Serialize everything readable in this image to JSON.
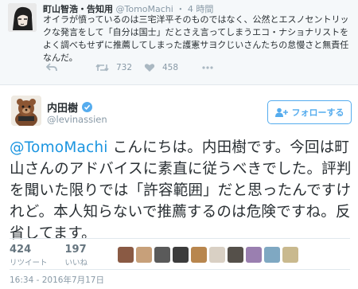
{
  "parent_tweet": {
    "name": "町山智浩・告知用",
    "handle": "@TomoMachi",
    "separator": "・",
    "time": "4 時間",
    "text": "オイラが憤っているのは三宅洋平そのものではなく、公然とエスノセントリックな発言をして「自分は国士」だとさえ言ってしまうエコ・ナショナリストをよく調べもせずに推薦してしまった護憲サヨクじいさんたちの怠慢さと無責任なんだ。",
    "actions": {
      "reply_icon": "reply-icon",
      "retweet_icon": "retweet-icon",
      "retweet_count": "732",
      "like_icon": "heart-icon",
      "like_count": "458",
      "more_icon": "more-icon"
    }
  },
  "main_tweet": {
    "name": "内田樹",
    "verified_icon": "verified-badge-icon",
    "handle": "@levinassien",
    "follow_label": "フォローする",
    "mention": "@TomoMachi",
    "text": " こんにちは。内田樹です。今回は町山さんのアドバイスに素直に従うべきでした。評判を聞いた限りでは「許容範囲」だと思ったんですけれど。本人知らないで推薦するのは危険ですね。反省してます。",
    "stats": {
      "retweets": "424",
      "retweets_label": "リツイート",
      "likes": "197",
      "likes_label": "いいね"
    },
    "likers": [
      "#8a5a44",
      "#c7a07a",
      "#5a5a5a",
      "#3c3c3c",
      "#b8864e",
      "#d9d0c4",
      "#55504a",
      "#9a7fb0",
      "#7fa8c2",
      "#c9b98e"
    ],
    "timestamp": "16:34 - 2016年7月17日"
  },
  "colors": {
    "accent": "#55acee",
    "mention": "#1b95e0",
    "muted": "#8899a6",
    "parent_bg": "#f5f8fa"
  }
}
